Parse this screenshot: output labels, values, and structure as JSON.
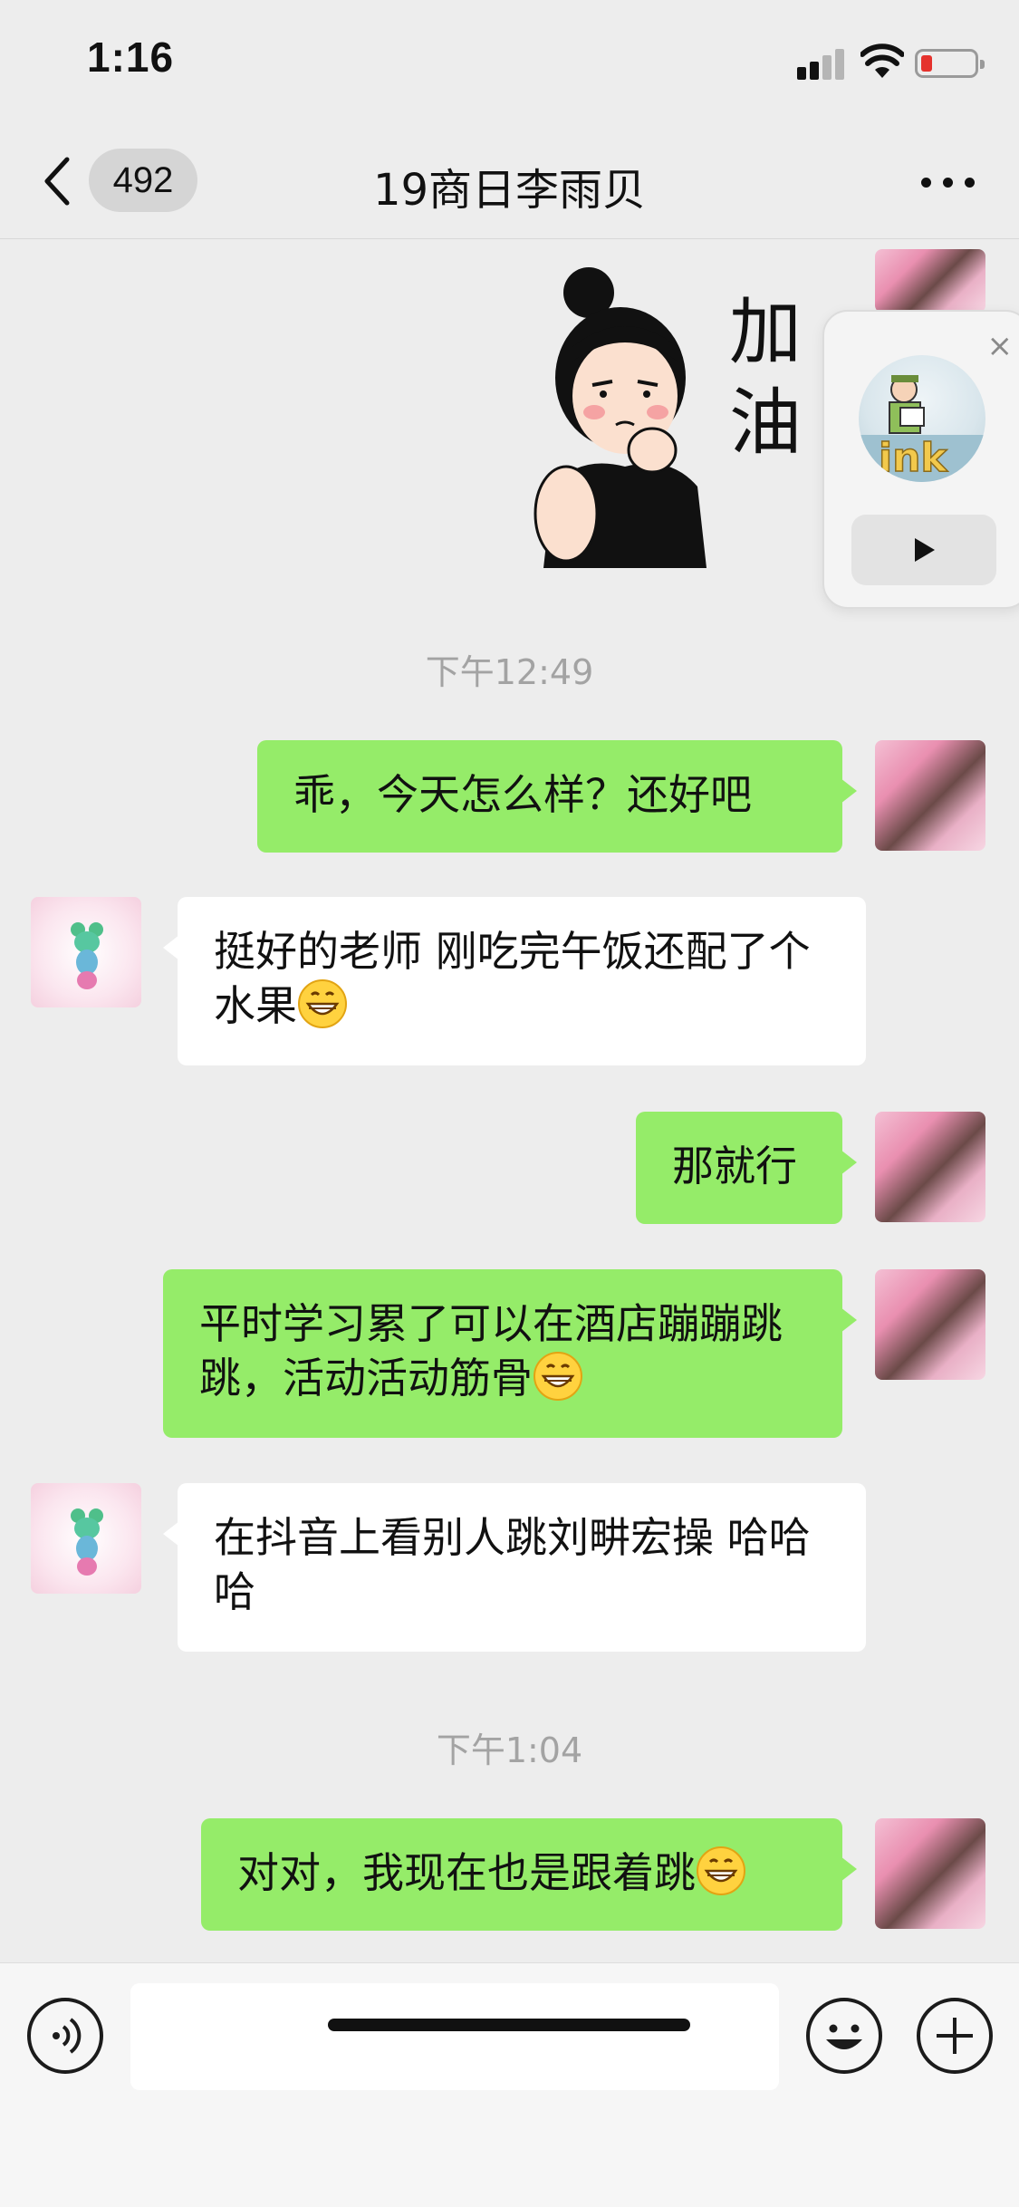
{
  "status_bar": {
    "time": "1:16"
  },
  "nav": {
    "unread_count": "492",
    "title": "19商日李雨贝"
  },
  "sticker": {
    "text": "加油"
  },
  "messages": [
    {
      "type": "time",
      "text": "下午12:49"
    },
    {
      "type": "me",
      "text": "乖，今天怎么样？还好吧"
    },
    {
      "type": "other",
      "text": "挺好的老师 刚吃完午饭还配了个水果"
    },
    {
      "type": "me",
      "text": "那就行"
    },
    {
      "type": "me",
      "text": "平时学习累了可以在酒店蹦蹦跳跳，活动活动筋骨"
    },
    {
      "type": "other",
      "text": "在抖音上看别人跳刘畊宏操 哈哈哈"
    },
    {
      "type": "time",
      "text": "下午1:04"
    },
    {
      "type": "me",
      "text": "对对，我现在也是跟着跳"
    }
  ],
  "float_window": {
    "close_symbol": "×",
    "thumb_text": "ink"
  },
  "icons": {
    "back": "chevron-left-icon",
    "more": "more-dots-icon",
    "voice": "voice-icon",
    "emoji": "emoji-icon",
    "plus": "plus-icon",
    "grin": "grinning-emoji-icon"
  },
  "colors": {
    "bubble_me": "#95ec69",
    "bubble_other": "#ffffff",
    "background": "#ededed"
  }
}
